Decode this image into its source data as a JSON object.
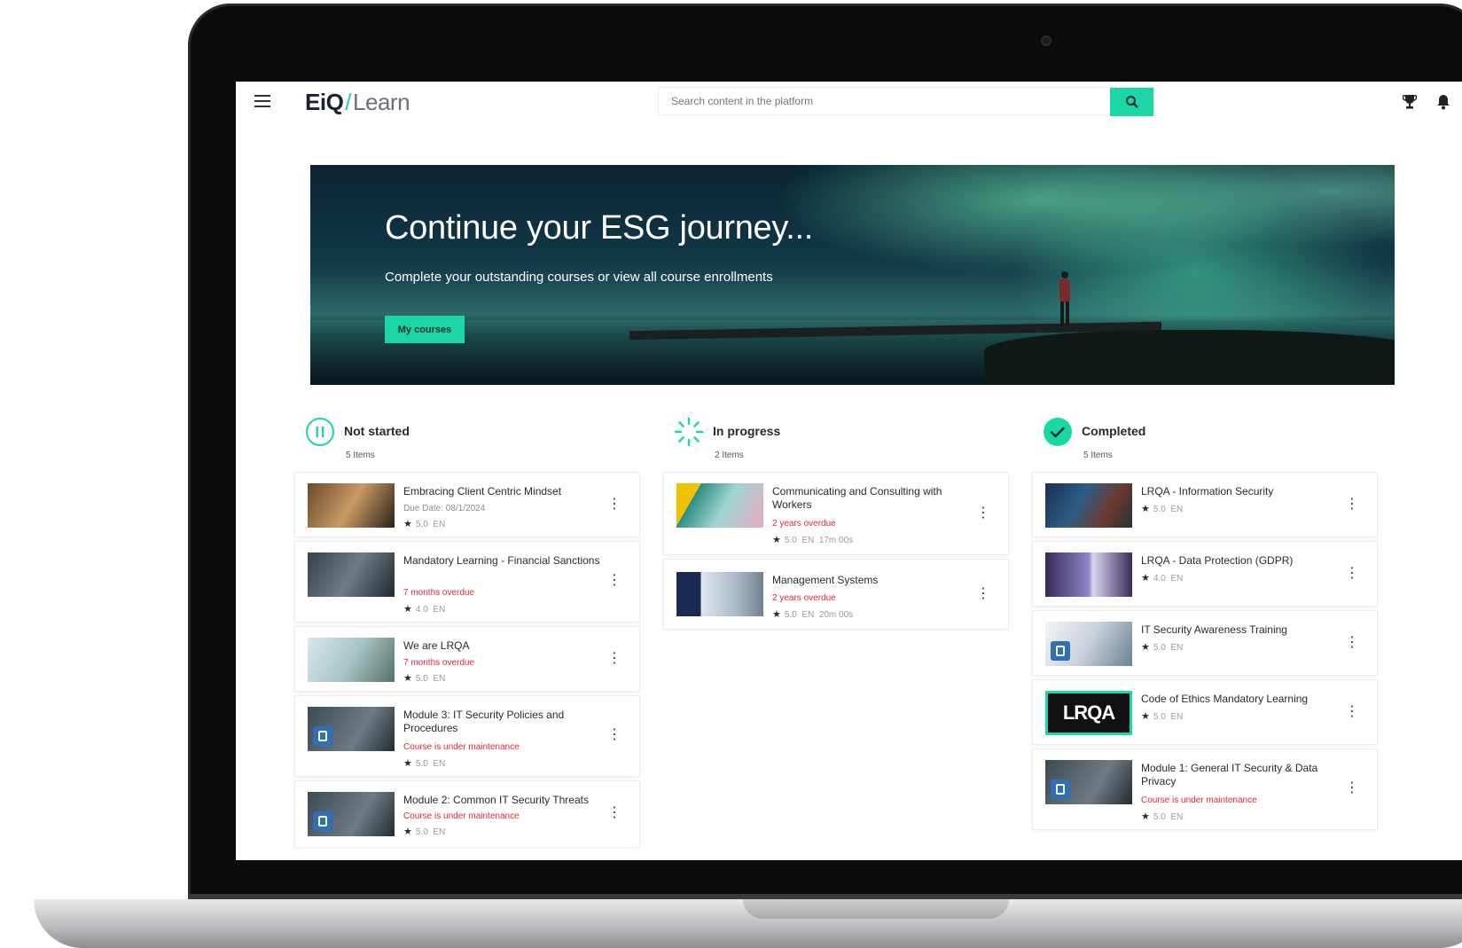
{
  "header": {
    "logo_main": "EiQ",
    "logo_slash": "/",
    "logo_product": "Learn",
    "search_placeholder": "Search content in the platform"
  },
  "hero": {
    "title": "Continue your ESG journey...",
    "subtitle": "Complete your outstanding courses or view all course enrollments",
    "button_label": "My courses"
  },
  "columns": {
    "not_started": {
      "title": "Not started",
      "count": "5 Items",
      "items": [
        {
          "title": "Embracing Client Centric Mindset",
          "meta": "Due Date: 08/1/2024",
          "rating": "5.0",
          "lang": "EN"
        },
        {
          "title": "Mandatory Learning - Financial Sanctions",
          "warn": "7 months overdue",
          "rating": "4.0",
          "lang": "EN"
        },
        {
          "title": "We are LRQA",
          "warn": "7 months overdue",
          "rating": "5.0",
          "lang": "EN"
        },
        {
          "title": "Module 3: IT Security Policies and Procedures",
          "warn": "Course is under maintenance",
          "rating": "5.0",
          "lang": "EN"
        },
        {
          "title": "Module 2: Common IT Security Threats",
          "warn": "Course is under maintenance",
          "rating": "5.0",
          "lang": "EN"
        }
      ]
    },
    "in_progress": {
      "title": "In progress",
      "count": "2 Items",
      "items": [
        {
          "title": "Communicating and Consulting with Workers",
          "warn": "2 years overdue",
          "rating": "5.0",
          "lang": "EN",
          "time": "17m 00s"
        },
        {
          "title": "Management Systems",
          "warn": "2 years overdue",
          "rating": "5.0",
          "lang": "EN",
          "time": "20m 00s"
        }
      ]
    },
    "completed": {
      "title": "Completed",
      "count": "5 Items",
      "items": [
        {
          "title": "LRQA - Information Security",
          "rating": "5.0",
          "lang": "EN"
        },
        {
          "title": "LRQA - Data Protection (GDPR)",
          "rating": "4.0",
          "lang": "EN"
        },
        {
          "title": "IT Security Awareness Training",
          "rating": "5.0",
          "lang": "EN"
        },
        {
          "title": "Code of Ethics Mandatory Learning",
          "rating": "5.0",
          "lang": "EN",
          "thumb_text": "LRQA"
        },
        {
          "title": "Module 1: General IT Security & Data Privacy",
          "warn": "Course is under maintenance",
          "rating": "5.0",
          "lang": "EN"
        }
      ]
    }
  },
  "colors": {
    "accent": "#1bd7a5",
    "warning": "#e0283c",
    "logo_slash": "#22c7b8"
  },
  "icons": [
    "menu-icon",
    "search-icon",
    "trophy-icon",
    "bell-icon",
    "pause-icon",
    "spinner-icon",
    "check-icon",
    "star-icon",
    "kebab-icon",
    "lock-icon"
  ]
}
